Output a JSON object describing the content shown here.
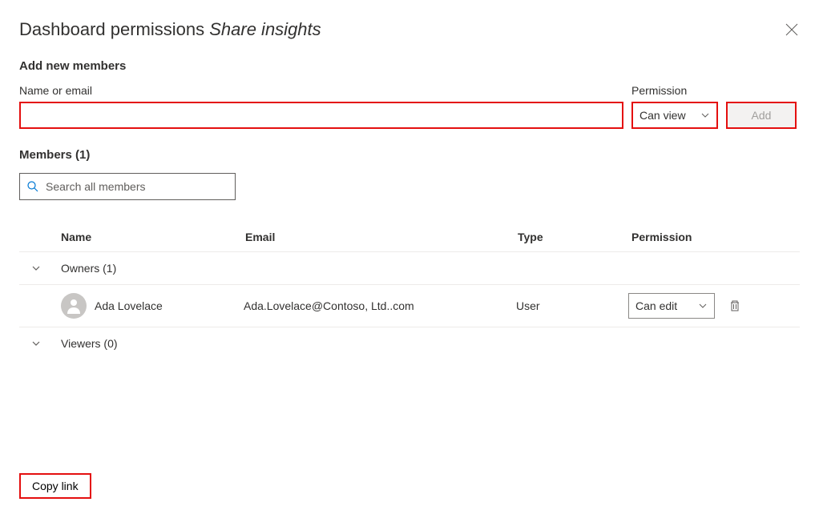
{
  "header": {
    "title_prefix": "Dashboard permissions ",
    "title_italic": "Share insights"
  },
  "addSection": {
    "heading": "Add new members",
    "nameLabel": "Name or email",
    "permLabel": "Permission",
    "permSelected": "Can view",
    "addButton": "Add"
  },
  "membersSection": {
    "heading": "Members (1)",
    "searchPlaceholder": "Search all members"
  },
  "table": {
    "columns": {
      "name": "Name",
      "email": "Email",
      "type": "Type",
      "permission": "Permission"
    },
    "groups": {
      "owners": "Owners (1)",
      "viewers": "Viewers (0)"
    },
    "member": {
      "name": "Ada Lovelace",
      "email": "Ada.Lovelace@Contoso, Ltd..com",
      "type": "User",
      "permission": "Can edit"
    }
  },
  "footer": {
    "copyLink": "Copy link"
  }
}
